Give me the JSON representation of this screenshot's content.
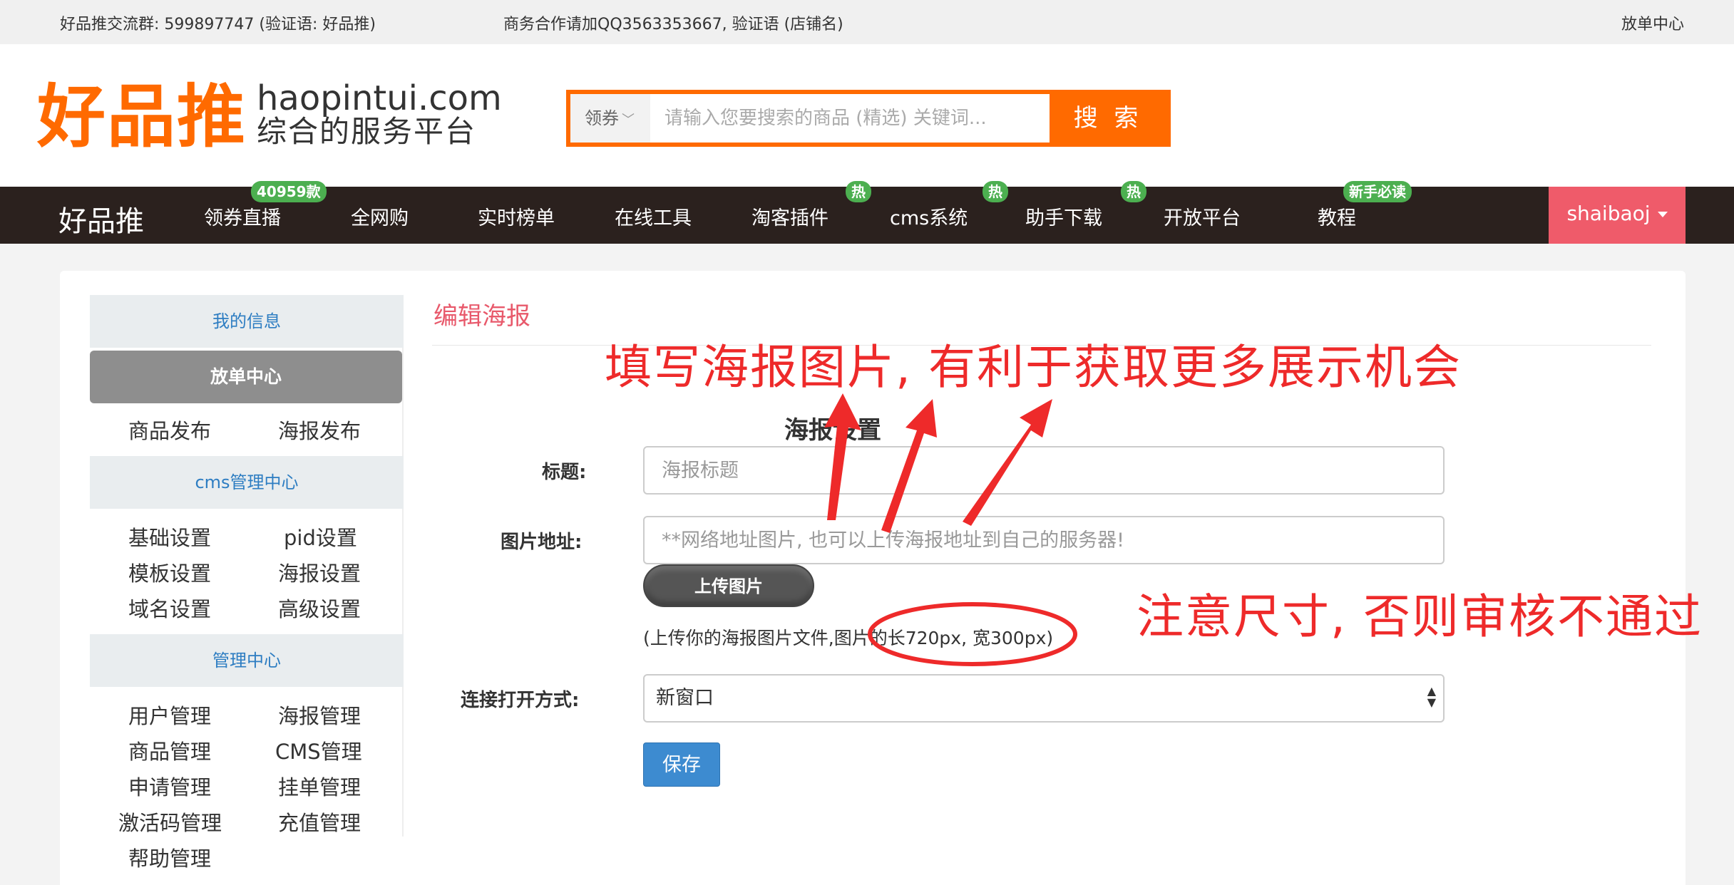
{
  "topbar": {
    "group": "好品推交流群: 599897747 (验证语: 好品推)",
    "business": "商务合作请加QQ3563353667, 验证语 (店铺名)",
    "order_center": "放单中心"
  },
  "logo": {
    "cn": "好品推",
    "domain": "haopintui.com",
    "subtitle": "综合的服务平台"
  },
  "search": {
    "type_label": "领券",
    "placeholder": "请输入您要搜索的商品 (精选) 关键词...",
    "button": "搜 索",
    "accent": "#ff6a00"
  },
  "nav": {
    "brand": "好品推",
    "items": [
      {
        "label": "领券直播",
        "badge": "40959款"
      },
      {
        "label": "全网购",
        "badge": ""
      },
      {
        "label": "实时榜单",
        "badge": ""
      },
      {
        "label": "在线工具",
        "badge": ""
      },
      {
        "label": "淘客插件",
        "badge": "热"
      },
      {
        "label": "cms系统",
        "badge": "热"
      },
      {
        "label": "助手下载",
        "badge": "热"
      },
      {
        "label": "开放平台",
        "badge": ""
      },
      {
        "label": "教程",
        "badge": "新手必读"
      }
    ],
    "user": "shaibaoj",
    "user_color": "#ef5b6a"
  },
  "sidebar": {
    "my_info": "我的信息",
    "order_center": "放单中心",
    "product_publish": "商品发布",
    "poster_publish": "海报发布",
    "cms_center": "cms管理中心",
    "cms_links": [
      "基础设置",
      "pid设置",
      "模板设置",
      "海报设置",
      "域名设置",
      "高级设置"
    ],
    "admin_center": "管理中心",
    "admin_links": [
      "用户管理",
      "海报管理",
      "商品管理",
      "CMS管理",
      "申请管理",
      "挂单管理",
      "激活码管理",
      "充值管理",
      "帮助管理"
    ]
  },
  "form": {
    "page_title": "编辑海报",
    "section_title": "海报设置",
    "title_label": "标题:",
    "title_placeholder": "海报标题",
    "image_label": "图片地址:",
    "image_placeholder": "**网络地址图片, 也可以上传海报地址到自己的服务器!",
    "upload_button": "上传图片",
    "hint": "(上传你的海报图片文件,图片的长720px, 宽300px)",
    "open_label": "连接打开方式:",
    "open_value": "新窗口",
    "save_button": "保存"
  },
  "annotations": {
    "top": "填写海报图片, 有利于获取更多展示机会",
    "right": "注意尺寸, 否则审核不通过",
    "color": "#ee2a2a"
  }
}
